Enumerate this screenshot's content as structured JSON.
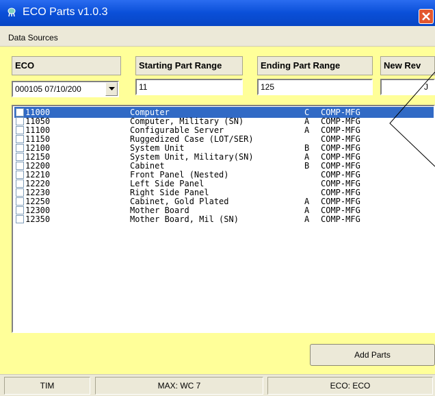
{
  "window": {
    "title": "ECO Parts v1.0.3"
  },
  "menu": {
    "data_sources": "Data Sources"
  },
  "fields": {
    "eco": {
      "label": "ECO",
      "value": "000105  07/10/200"
    },
    "start": {
      "label": "Starting Part Range",
      "value": "11"
    },
    "end": {
      "label": "Ending Part Range",
      "value": "125"
    },
    "newrev": {
      "label": "New Rev",
      "value": "J"
    }
  },
  "parts": [
    {
      "part": "11000",
      "desc": "Computer",
      "rev": "C",
      "loc": "COMP-MFG",
      "selected": true
    },
    {
      "part": "11050",
      "desc": "Computer, Military (SN)",
      "rev": "A",
      "loc": "COMP-MFG"
    },
    {
      "part": "11100",
      "desc": "Configurable Server",
      "rev": "A",
      "loc": "COMP-MFG"
    },
    {
      "part": "11150",
      "desc": "Ruggedized Case (LOT/SER)",
      "rev": "",
      "loc": "COMP-MFG"
    },
    {
      "part": "12100",
      "desc": "System Unit",
      "rev": "B",
      "loc": "COMP-MFG"
    },
    {
      "part": "12150",
      "desc": "System Unit, Military(SN)",
      "rev": "A",
      "loc": "COMP-MFG"
    },
    {
      "part": "12200",
      "desc": "Cabinet",
      "rev": "B",
      "loc": "COMP-MFG"
    },
    {
      "part": "12210",
      "desc": "Front Panel (Nested)",
      "rev": "",
      "loc": "COMP-MFG"
    },
    {
      "part": "12220",
      "desc": "Left Side Panel",
      "rev": "",
      "loc": "COMP-MFG"
    },
    {
      "part": "12230",
      "desc": "Right Side Panel",
      "rev": "",
      "loc": "COMP-MFG"
    },
    {
      "part": "12250",
      "desc": "Cabinet, Gold Plated",
      "rev": "A",
      "loc": "COMP-MFG"
    },
    {
      "part": "12300",
      "desc": "Mother Board",
      "rev": "A",
      "loc": "COMP-MFG"
    },
    {
      "part": "12350",
      "desc": "Mother Board, Mil (SN)",
      "rev": "A",
      "loc": "COMP-MFG"
    }
  ],
  "buttons": {
    "add_parts": "Add Parts"
  },
  "status": {
    "user": "TIM",
    "max": "MAX: WC 7",
    "eco": "ECO: ECO"
  },
  "icons": {
    "title": "app-icon",
    "close": "close-icon",
    "dropdown": "chevron-down-icon"
  }
}
